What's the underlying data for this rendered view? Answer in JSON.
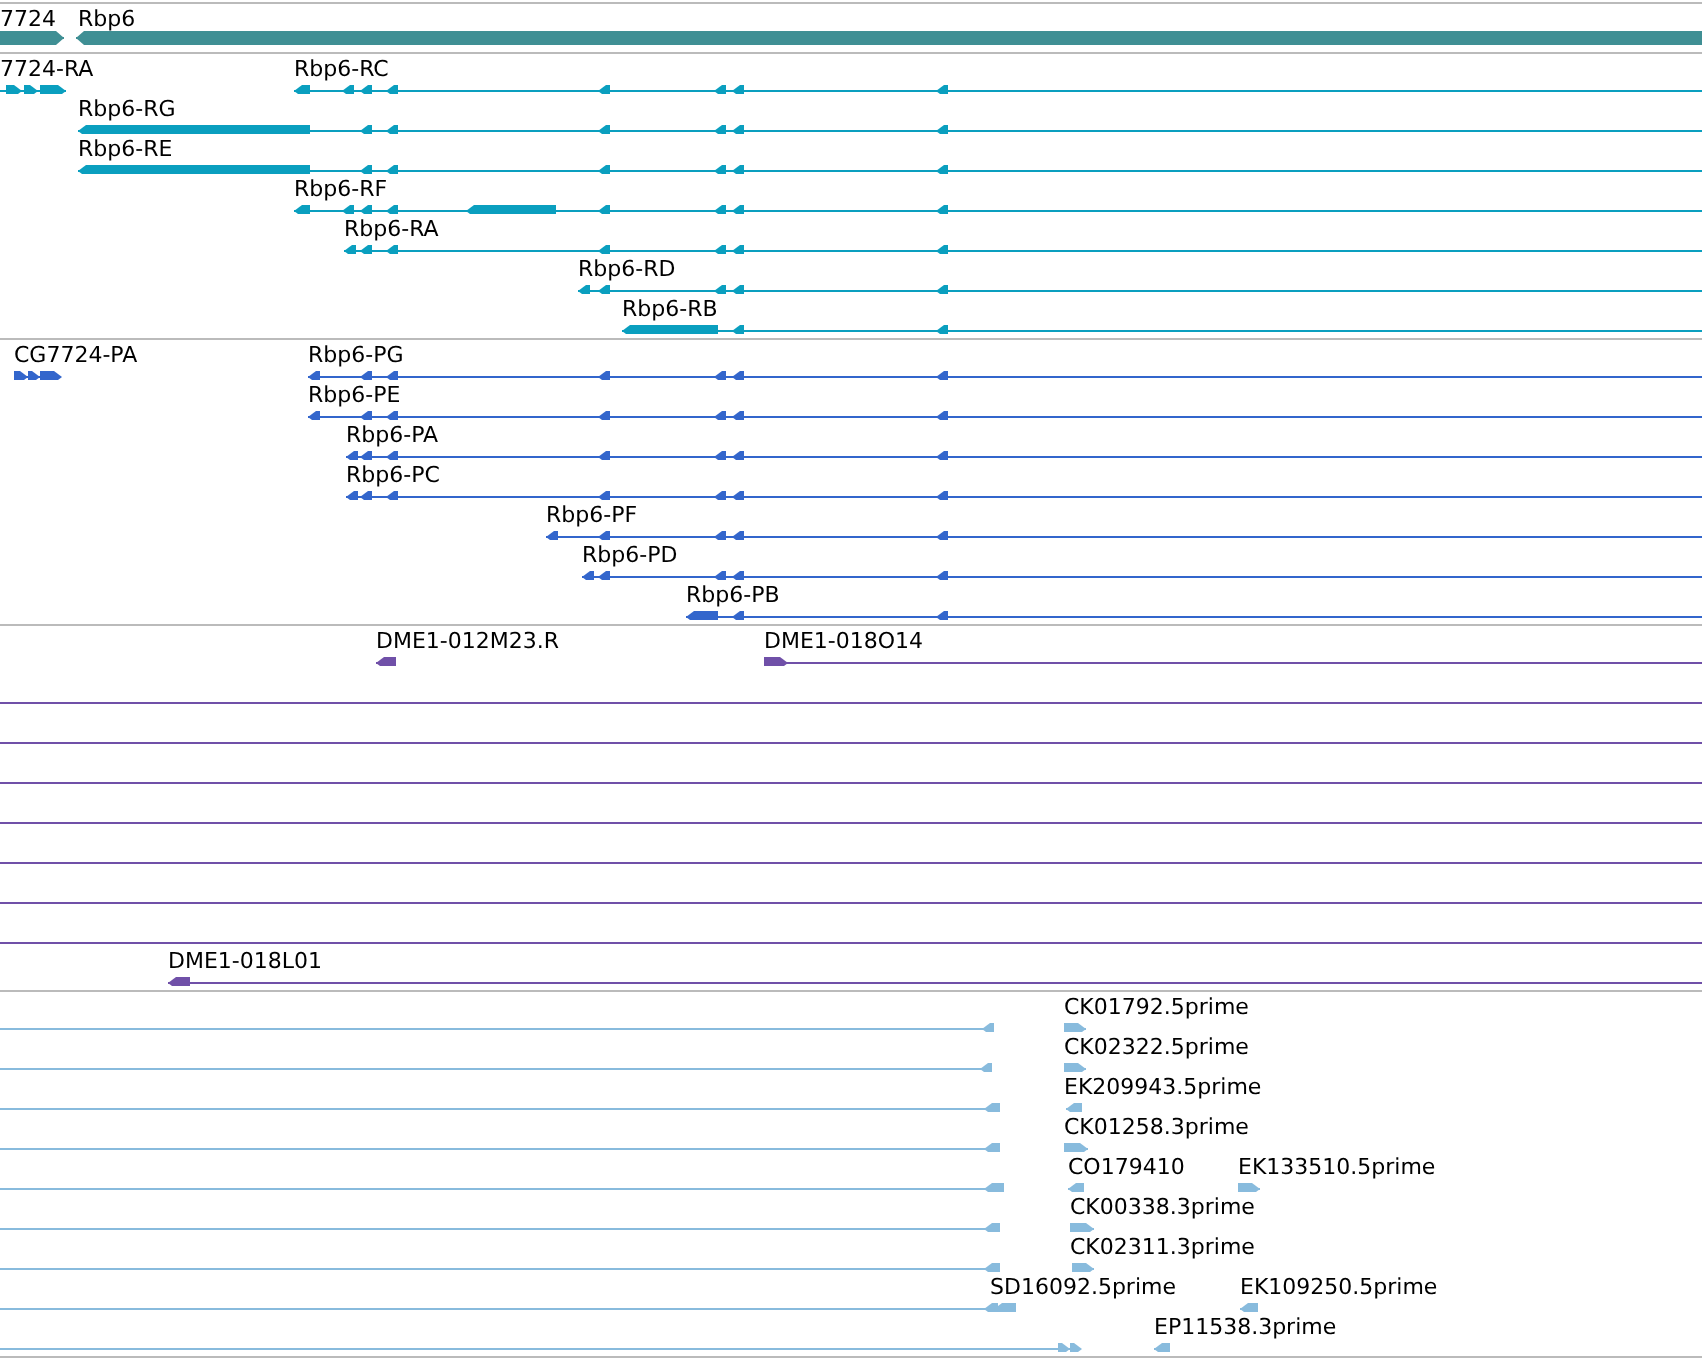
{
  "tracks": [
    {
      "kind": "gene",
      "color": "#3f8f94",
      "labels": [
        "7724",
        "Rbp6"
      ]
    },
    {
      "kind": "transcript",
      "color": "#0a9fbf",
      "labels": [
        "7724-RA",
        "Rbp6-RC",
        "Rbp6-RG",
        "Rbp6-RE",
        "Rbp6-RF",
        "Rbp6-RA",
        "Rbp6-RD",
        "Rbp6-RB"
      ]
    },
    {
      "kind": "protein",
      "color": "#3366cc",
      "labels": [
        "CG7724-PA",
        "Rbp6-PG",
        "Rbp6-PE",
        "Rbp6-PA",
        "Rbp6-PC",
        "Rbp6-PF",
        "Rbp6-PD",
        "Rbp6-PB"
      ]
    },
    {
      "kind": "clone",
      "color": "#7050a8",
      "labels": [
        "DME1-012M23.R",
        "DME1-018O14",
        "DME1-018L01"
      ]
    },
    {
      "kind": "est",
      "color": "#88bbdd",
      "labels": [
        "CK01792.5prime",
        "CK02322.5prime",
        "EK209943.5prime",
        "CK01258.3prime",
        "CO179410",
        "EK133510.5prime",
        "CK00338.3prime",
        "CK02311.3prime",
        "SD16092.5prime",
        "EK109250.5prime",
        "EP11538.3prime"
      ]
    }
  ]
}
